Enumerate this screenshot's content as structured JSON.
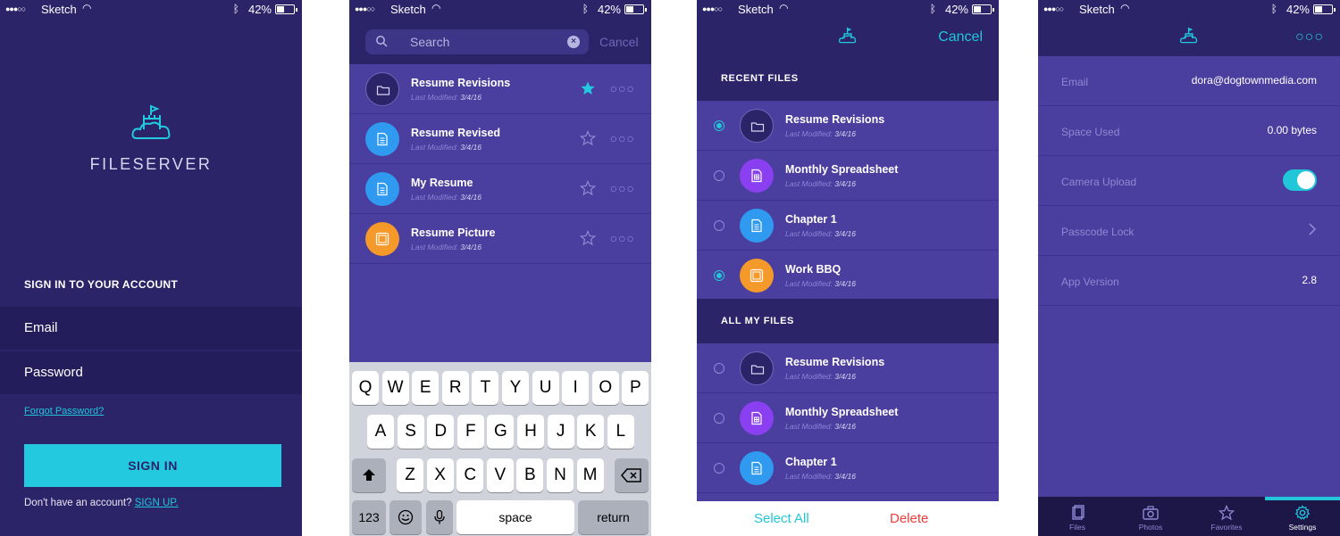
{
  "status_bar": {
    "carrier": "Sketch",
    "battery": "42%"
  },
  "colors": {
    "accent": "#22c9df",
    "deep_purple": "#2b2469",
    "panel_purple": "#4a3f9e",
    "delete_red": "#ef3b3b"
  },
  "login": {
    "brand": "FILESERVER",
    "heading": "SIGN IN TO YOUR ACCOUNT",
    "email_placeholder": "Email",
    "password_placeholder": "Password",
    "forgot_link": "Forgot Password?",
    "signin_button": "SIGN IN",
    "no_account_text": "Don't have an account?",
    "signup_link": "SIGN UP."
  },
  "search": {
    "placeholder": "Search",
    "cancel": "Cancel",
    "results": [
      {
        "name": "Resume Revisions",
        "meta_label": "Last Modified:",
        "date": "3/4/16",
        "icon": "folder-icon",
        "starred": true
      },
      {
        "name": "Resume Revised",
        "meta_label": "Last Modified:",
        "date": "3/4/16",
        "icon": "document-icon",
        "starred": false
      },
      {
        "name": "My Resume",
        "meta_label": "Last Modified:",
        "date": "3/4/16",
        "icon": "document-icon",
        "starred": false
      },
      {
        "name": "Resume Picture",
        "meta_label": "Last Modified:",
        "date": "3/4/16",
        "icon": "image-icon",
        "starred": false
      }
    ],
    "keyboard": {
      "row1": [
        "Q",
        "W",
        "E",
        "R",
        "T",
        "Y",
        "U",
        "I",
        "O",
        "P"
      ],
      "row2": [
        "A",
        "S",
        "D",
        "F",
        "G",
        "H",
        "J",
        "K",
        "L"
      ],
      "row3": [
        "Z",
        "X",
        "C",
        "V",
        "B",
        "N",
        "M"
      ],
      "numbers_key": "123",
      "space_key": "space",
      "return_key": "return"
    }
  },
  "select_files": {
    "cancel": "Cancel",
    "recent_header": "RECENT FILES",
    "all_header": "ALL MY FILES",
    "recent": [
      {
        "name": "Resume Revisions",
        "meta_label": "Last Modified:",
        "date": "3/4/16",
        "icon": "folder-icon",
        "selected": true
      },
      {
        "name": "Monthly Spreadsheet",
        "meta_label": "Last Modified:",
        "date": "3/4/16",
        "icon": "spreadsheet-icon",
        "selected": false
      },
      {
        "name": "Chapter 1",
        "meta_label": "Last Modified:",
        "date": "3/4/16",
        "icon": "document-icon",
        "selected": false
      },
      {
        "name": "Work BBQ",
        "meta_label": "Last Modified:",
        "date": "3/4/16",
        "icon": "image-icon",
        "selected": true
      }
    ],
    "all": [
      {
        "name": "Resume Revisions",
        "meta_label": "Last Modified:",
        "date": "3/4/16",
        "icon": "folder-icon",
        "selected": false
      },
      {
        "name": "Monthly Spreadsheet",
        "meta_label": "Last Modified:",
        "date": "3/4/16",
        "icon": "spreadsheet-icon",
        "selected": false
      },
      {
        "name": "Chapter 1",
        "meta_label": "Last Modified:",
        "date": "3/4/16",
        "icon": "document-icon",
        "selected": false
      }
    ],
    "select_all": "Select All",
    "delete": "Delete"
  },
  "settings": {
    "rows": [
      {
        "label": "Email",
        "value": "dora@dogtownmedia.com"
      },
      {
        "label": "Space Used",
        "value": "0.00 bytes"
      },
      {
        "label": "Camera Upload",
        "toggle_on": true
      },
      {
        "label": "Passcode Lock"
      },
      {
        "label": "App Version",
        "value": "2.8"
      }
    ],
    "tabs": [
      "Files",
      "Photos",
      "Favorites",
      "Settings"
    ],
    "active_tab": "Settings"
  }
}
